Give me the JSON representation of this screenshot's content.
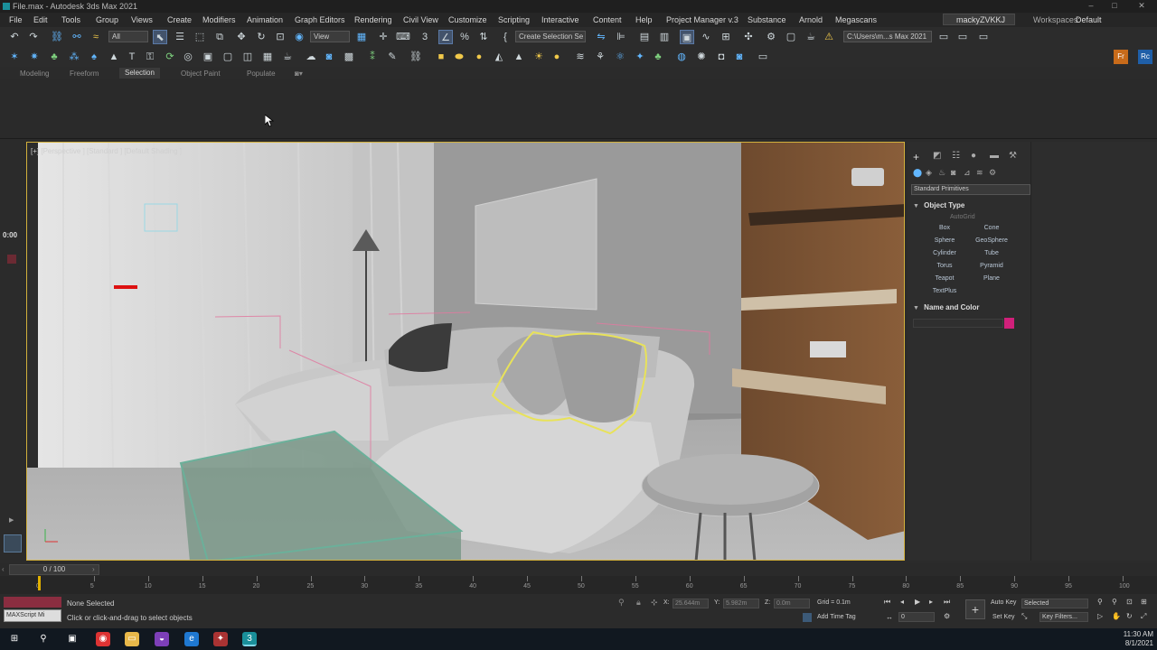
{
  "window": {
    "title": "File.max - Autodesk 3ds Max 2021",
    "min": "–",
    "max": "□",
    "close": "✕"
  },
  "menu": {
    "items": [
      "File",
      "Edit",
      "Tools",
      "Group",
      "Views",
      "Create",
      "Modifiers",
      "Animation",
      "Graph Editors",
      "Rendering",
      "Civil View",
      "Customize",
      "Scripting",
      "Interactive",
      "Content",
      "Help",
      "Project Manager v.3",
      "Substance",
      "Arnold",
      "Megascans"
    ],
    "user": "mackyZVKKJ",
    "workspaces_label": "Workspaces:",
    "workspace_value": "Default"
  },
  "toolbar": {
    "filter_all": "All",
    "view_dropdown": "View",
    "selection_set": "Create Selection Se",
    "project_path": "C:\\Users\\m...s Max 2021"
  },
  "ribbon": {
    "tabs": [
      "Modeling",
      "Freeform",
      "Selection",
      "Object Paint",
      "Populate"
    ],
    "active_tab": "Selection"
  },
  "viewport": {
    "label": "[+] [Perspective ] [Standard ] [Default Shading ]",
    "selection_color": "#e8e25a",
    "helper_color": "#e07aa0"
  },
  "left_strip": {
    "time": "0:00"
  },
  "command_panel": {
    "category": "Standard Primitives",
    "object_type_title": "Object Type",
    "autogrid": "AutoGrid",
    "buttons": [
      "Box",
      "Cone",
      "Sphere",
      "GeoSphere",
      "Cylinder",
      "Tube",
      "Torus",
      "Pyramid",
      "Teapot",
      "Plane",
      "TextPlus"
    ],
    "name_color_title": "Name and Color",
    "swatch_color": "#d0207a"
  },
  "timeline": {
    "frame": "0 / 100",
    "ticks": [
      0,
      5,
      10,
      15,
      20,
      25,
      30,
      35,
      40,
      45,
      50,
      55,
      60,
      65,
      70,
      75,
      80,
      85,
      90,
      95,
      100
    ]
  },
  "status": {
    "maxscript": "MAXScript Mi",
    "selection": "None Selected",
    "prompt": "Click or click-and-drag to select objects",
    "x_label": "X:",
    "x_value": "25.644m",
    "y_label": "Y:",
    "y_value": "5.982m",
    "z_label": "Z:",
    "z_value": "0.0m",
    "grid": "Grid = 0.1m",
    "add_time_tag": "Add Time Tag",
    "auto_key": "Auto Key",
    "set_key": "Set Key",
    "selected": "Selected",
    "key_filters": "Key Filters...",
    "frame_field": "0"
  },
  "taskbar": {
    "time": "11:30 AM",
    "date": "8/1/2021"
  }
}
